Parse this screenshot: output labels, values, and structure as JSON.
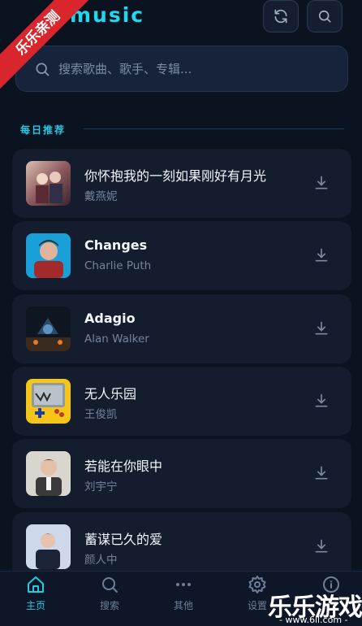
{
  "header": {
    "brand": "music",
    "refresh_icon": "refresh-icon",
    "search_icon": "search-icon"
  },
  "ribbon": {
    "text": "乐乐亲测"
  },
  "search": {
    "placeholder": "搜索歌曲、歌手、专辑...",
    "value": ""
  },
  "section": {
    "title": "每日推荐"
  },
  "songs": [
    {
      "title": "你怀抱我的一刻如果刚好有月光",
      "artist": "戴燕妮"
    },
    {
      "title": "Changes",
      "artist": "Charlie Puth"
    },
    {
      "title": "Adagio",
      "artist": "Alan Walker"
    },
    {
      "title": "无人乐园",
      "artist": "王俊凯"
    },
    {
      "title": "若能在你眼中",
      "artist": "刘宇宁"
    },
    {
      "title": "蓄谋已久的爱",
      "artist": "颜人中"
    }
  ],
  "nav": [
    {
      "label": "主页",
      "icon": "home-icon",
      "active": true
    },
    {
      "label": "搜索",
      "icon": "search-icon",
      "active": false
    },
    {
      "label": "其他",
      "icon": "more-icon",
      "active": false
    },
    {
      "label": "设置",
      "icon": "gear-icon",
      "active": false
    },
    {
      "label": "",
      "icon": "info-icon",
      "active": false
    }
  ],
  "watermark": {
    "text": "乐乐游戏",
    "url": "- www.6ll.com -"
  },
  "colors": {
    "accent": "#22c9e3",
    "background": "#0b1220",
    "card": "#141d2d"
  }
}
